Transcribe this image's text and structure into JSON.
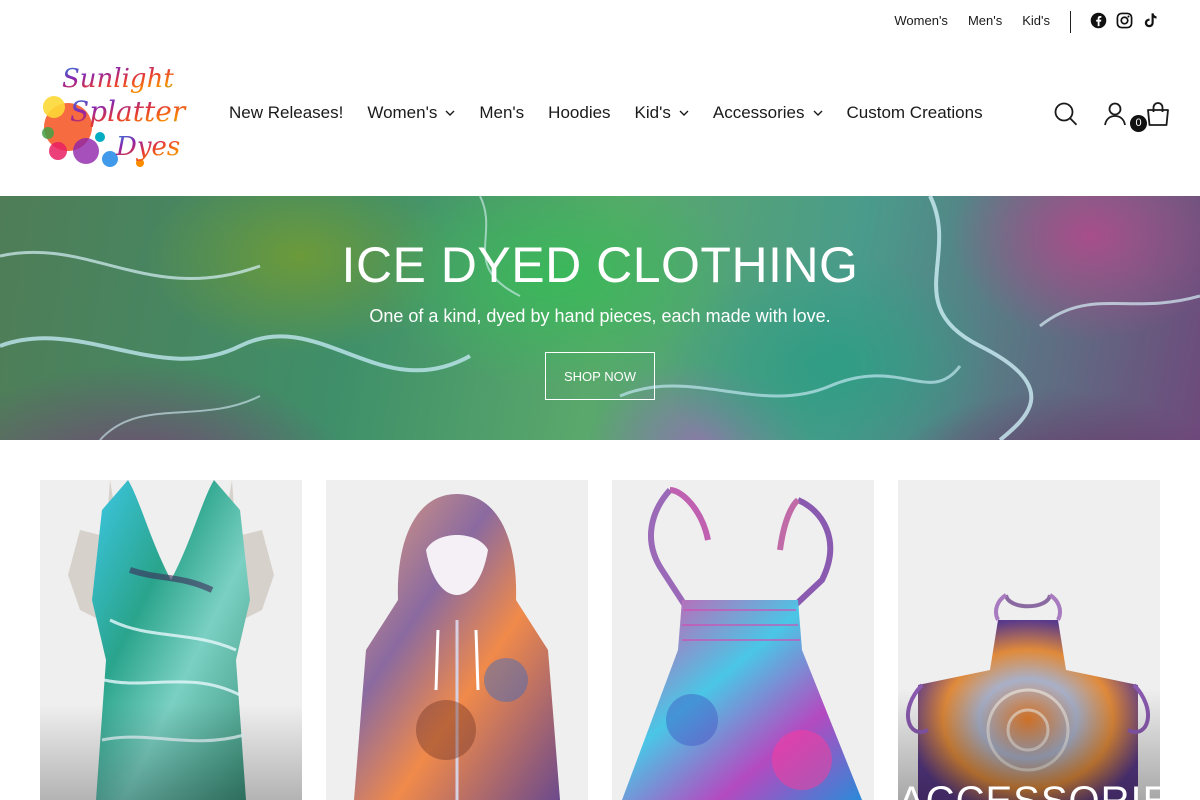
{
  "utility": {
    "links": [
      "Women's",
      "Men's",
      "Kid's"
    ]
  },
  "logo": {
    "lines": [
      "Sunlight",
      "Splatter",
      "Dyes"
    ]
  },
  "nav": {
    "items": [
      {
        "label": "New Releases!"
      },
      {
        "label": "Women's"
      },
      {
        "label": "Men's"
      },
      {
        "label": "Hoodies"
      },
      {
        "label": "Kid's"
      },
      {
        "label": "Accessories"
      },
      {
        "label": "Custom Creations"
      }
    ]
  },
  "cart": {
    "count": "0"
  },
  "hero": {
    "title": "ICE DYED CLOTHING",
    "subtitle": "One of a kind, dyed by hand pieces, each made with love.",
    "button": "SHOP NOW"
  },
  "tiles": {
    "accessories_label": "ACCESSORIES"
  },
  "colors": {
    "text": "#1a1a1a",
    "cart_badge": "#111111",
    "tile_background": "#efefef"
  },
  "icons": [
    "facebook-icon",
    "instagram-icon",
    "tiktok-icon",
    "search-icon",
    "account-icon",
    "cart-icon",
    "chevron-down-icon"
  ]
}
